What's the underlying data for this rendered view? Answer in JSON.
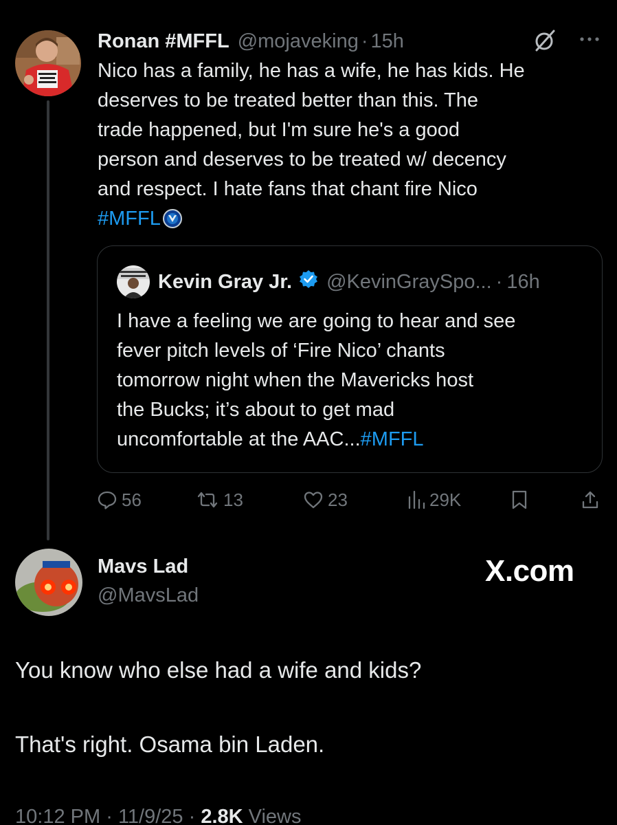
{
  "parent_tweet": {
    "author_name": "Ronan #MFFL",
    "handle": "@mojaveking",
    "separator": "·",
    "time": "15h",
    "text_lines": [
      "Nico has a family, he has a wife, he has kids. He",
      "deserves to be treated better than this. The",
      "trade happened, but I'm sure he's a good",
      "person and deserves to be treated w/ decency",
      "and respect. I hate fans that chant fire Nico"
    ],
    "hashtag": "#MFFL",
    "icons": {
      "grok": "grok-icon",
      "more": "more-icon",
      "team_logo": "mavericks-logo-icon"
    }
  },
  "quoted_tweet": {
    "author_name": "Kevin Gray Jr.",
    "handle": "@KevinGraySpo...",
    "separator": "·",
    "time": "16h",
    "text_lines": [
      "I have a feeling we are going to hear and see",
      "fever pitch levels of ‘Fire Nico’ chants",
      "tomorrow night when the Mavericks host",
      "the Bucks; it’s about to get mad"
    ],
    "last_line_text": "uncomfortable at the AAC...",
    "hashtag": "#MFFL"
  },
  "actions": {
    "replies": "56",
    "reposts": "13",
    "likes": "23",
    "views": "29K"
  },
  "reply_tweet": {
    "author_name": "Mavs Lad",
    "handle": "@MavsLad",
    "watermark": "X.com",
    "text_1": "You know who else had a wife and kids?",
    "text_2": "That's right. Osama bin Laden.",
    "time": "10:12 PM",
    "date": "11/9/25",
    "views_count": "2.8K",
    "views_label": "Views",
    "separator": "·"
  },
  "colors": {
    "background": "#000000",
    "text": "#e7e9ea",
    "muted": "#71767b",
    "link": "#1d9bf0",
    "border": "#2f3336"
  }
}
